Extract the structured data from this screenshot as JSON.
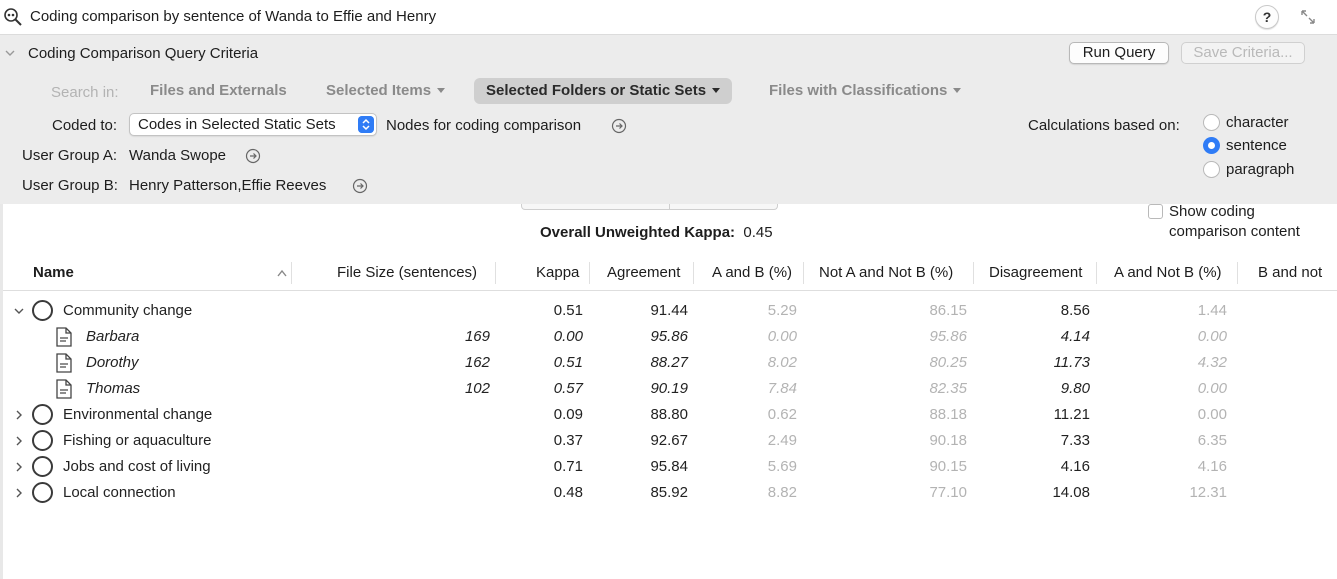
{
  "window": {
    "title": "Coding comparison by sentence of Wanda to Effie and Henry",
    "help_label": "?"
  },
  "criteria": {
    "title": "Coding Comparison Query Criteria",
    "run_label": "Run Query",
    "save_label": "Save Criteria...",
    "search_in_label": "Search in:",
    "scopes": [
      {
        "label": "Files and Externals",
        "active": false
      },
      {
        "label": "Selected Items",
        "active": false
      },
      {
        "label": "Selected Folders or Static Sets",
        "active": true
      },
      {
        "label": "Files with Classifications",
        "active": false
      }
    ],
    "coded_to_label": "Coded to:",
    "coded_to_value": "Codes in Selected Static Sets",
    "nodes_label": "Nodes for coding comparison",
    "group_a_label": "User Group A:",
    "group_a_value": "Wanda Swope",
    "group_b_label": "User Group B:",
    "group_b_value": "Henry Patterson,Effie Reeves",
    "calc_label": "Calculations based on:",
    "calc_options": [
      {
        "label": "character",
        "selected": false
      },
      {
        "label": "sentence",
        "selected": true
      },
      {
        "label": "paragraph",
        "selected": false
      }
    ]
  },
  "summary": {
    "kappa_label": "Overall Unweighted Kappa:",
    "kappa_value": "0.45",
    "show_content_line1": "Show coding",
    "show_content_line2": "comparison content"
  },
  "table": {
    "columns": [
      "Name",
      "File Size (sentences)",
      "Kappa",
      "Agreement",
      "A and B (%)",
      "Not A and Not B (%)",
      "Disagreement",
      "A and Not B (%)",
      "B and not"
    ],
    "rows": [
      {
        "name": "Community change",
        "type": "node",
        "expanded": true,
        "size": "",
        "kappa": "0.51",
        "agreement": "91.44",
        "ab": "5.29",
        "notab": "86.15",
        "disagreement": "8.56",
        "anotb": "1.44"
      },
      {
        "name": "Barbara",
        "type": "file",
        "size": "169",
        "kappa": "0.00",
        "agreement": "95.86",
        "ab": "0.00",
        "notab": "95.86",
        "disagreement": "4.14",
        "anotb": "0.00"
      },
      {
        "name": "Dorothy",
        "type": "file",
        "size": "162",
        "kappa": "0.51",
        "agreement": "88.27",
        "ab": "8.02",
        "notab": "80.25",
        "disagreement": "11.73",
        "anotb": "4.32"
      },
      {
        "name": "Thomas",
        "type": "file",
        "size": "102",
        "kappa": "0.57",
        "agreement": "90.19",
        "ab": "7.84",
        "notab": "82.35",
        "disagreement": "9.80",
        "anotb": "0.00"
      },
      {
        "name": "Environmental change",
        "type": "node",
        "expanded": false,
        "size": "",
        "kappa": "0.09",
        "agreement": "88.80",
        "ab": "0.62",
        "notab": "88.18",
        "disagreement": "11.21",
        "anotb": "0.00"
      },
      {
        "name": "Fishing or aquaculture",
        "type": "node",
        "expanded": false,
        "size": "",
        "kappa": "0.37",
        "agreement": "92.67",
        "ab": "2.49",
        "notab": "90.18",
        "disagreement": "7.33",
        "anotb": "6.35"
      },
      {
        "name": "Jobs and cost of living",
        "type": "node",
        "expanded": false,
        "size": "",
        "kappa": "0.71",
        "agreement": "95.84",
        "ab": "5.69",
        "notab": "90.15",
        "disagreement": "4.16",
        "anotb": "4.16"
      },
      {
        "name": "Local connection",
        "type": "node",
        "expanded": false,
        "size": "",
        "kappa": "0.48",
        "agreement": "85.92",
        "ab": "8.82",
        "notab": "77.10",
        "disagreement": "14.08",
        "anotb": "12.31"
      }
    ]
  },
  "colors": {
    "accent": "#2f7cf6",
    "panel": "#ececec",
    "dim_text": "#b3b3b3"
  }
}
